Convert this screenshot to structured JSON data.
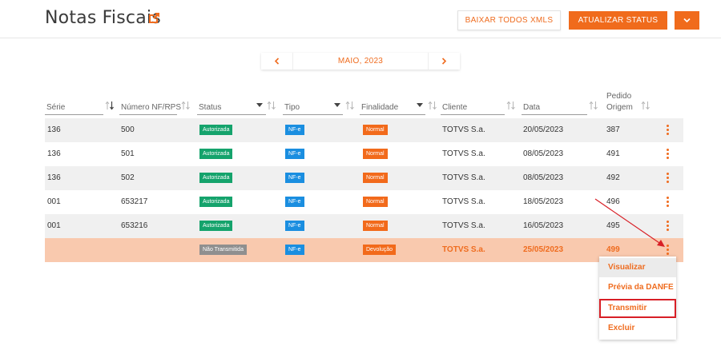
{
  "header": {
    "title": "Notas Fiscais",
    "download_all_label": "BAIXAR TODOS XMLS",
    "update_status_label": "ATUALIZAR STATUS"
  },
  "month_nav": {
    "label": "MAIO, 2023"
  },
  "columns": {
    "serie": "Série",
    "numero": "Número NF/RPS",
    "status": "Status",
    "tipo": "Tipo",
    "finalidade": "Finalidade",
    "cliente": "Cliente",
    "data": "Data",
    "pedido_line1": "Pedido",
    "pedido_line2": "Origem"
  },
  "rows": [
    {
      "serie": "136",
      "numero": "500",
      "status": "Autorizada",
      "tipo": "NF-e",
      "finalidade": "Normal",
      "cliente": "TOTVS S.a.",
      "data": "20/05/2023",
      "pedido": "387"
    },
    {
      "serie": "136",
      "numero": "501",
      "status": "Autorizada",
      "tipo": "NF-e",
      "finalidade": "Normal",
      "cliente": "TOTVS S.a.",
      "data": "08/05/2023",
      "pedido": "491"
    },
    {
      "serie": "136",
      "numero": "502",
      "status": "Autorizada",
      "tipo": "NF-e",
      "finalidade": "Normal",
      "cliente": "TOTVS S.a.",
      "data": "08/05/2023",
      "pedido": "492"
    },
    {
      "serie": "001",
      "numero": "653217",
      "status": "Autorizada",
      "tipo": "NF-e",
      "finalidade": "Normal",
      "cliente": "TOTVS S.a.",
      "data": "18/05/2023",
      "pedido": "496"
    },
    {
      "serie": "001",
      "numero": "653216",
      "status": "Autorizada",
      "tipo": "NF-e",
      "finalidade": "Normal",
      "cliente": "TOTVS S.a.",
      "data": "16/05/2023",
      "pedido": "495"
    },
    {
      "serie": "",
      "numero": "",
      "status": "Não Transmitida",
      "tipo": "NF-e",
      "finalidade": "Devolução",
      "cliente": "TOTVS S.a.",
      "data": "25/05/2023",
      "pedido": "499"
    }
  ],
  "context_menu": {
    "items": [
      "Visualizar",
      "Prévia da DANFE",
      "Transmitir",
      "Excluir"
    ]
  },
  "colors": {
    "accent": "#f06b1c",
    "status_authorized": "#15a36c",
    "type_nfe": "#1a8ee0",
    "status_not_transmitted": "#8f8f8f",
    "highlight_row": "#f9c9ae",
    "callout": "#d81f26"
  }
}
